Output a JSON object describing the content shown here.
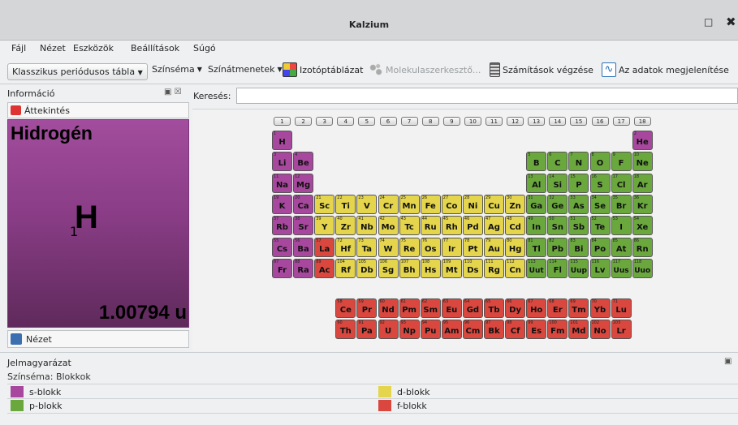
{
  "window": {
    "title": "Kalzium"
  },
  "menu": [
    "Fájl",
    "Nézet",
    "Eszközök",
    "Beállítások",
    "Súgó"
  ],
  "toolbar": {
    "table_combo": "Klasszikus periódusos tábla",
    "color_scheme": "Színséma",
    "gradients": "Színátmenetek",
    "isotope": "Izotóptáblázat",
    "molecule": "Molekulaszerkesztő...",
    "calc": "Számítások végzése",
    "data": "Az adatok megjelenítése"
  },
  "panel": {
    "title": "Információ",
    "overview": "Áttekintés",
    "view": "Nézet"
  },
  "element": {
    "name": "Hidrogén",
    "symbol": "H",
    "number": "1",
    "mass": "1.00794 u"
  },
  "search": {
    "label": "Keresés:",
    "value": ""
  },
  "groups": [
    "1",
    "2",
    "3",
    "4",
    "5",
    "6",
    "7",
    "8",
    "9",
    "10",
    "11",
    "12",
    "13",
    "14",
    "15",
    "16",
    "17",
    "18"
  ],
  "colors": {
    "s": "#a7489e",
    "p": "#6aa83d",
    "d": "#e4d54c",
    "f": "#d9473e"
  },
  "elements": [
    [
      1,
      "H",
      1,
      1,
      "s"
    ],
    [
      2,
      "He",
      1,
      18,
      "s"
    ],
    [
      3,
      "Li",
      2,
      1,
      "s"
    ],
    [
      4,
      "Be",
      2,
      2,
      "s"
    ],
    [
      5,
      "B",
      2,
      13,
      "p"
    ],
    [
      6,
      "C",
      2,
      14,
      "p"
    ],
    [
      7,
      "N",
      2,
      15,
      "p"
    ],
    [
      8,
      "O",
      2,
      16,
      "p"
    ],
    [
      9,
      "F",
      2,
      17,
      "p"
    ],
    [
      10,
      "Ne",
      2,
      18,
      "p"
    ],
    [
      11,
      "Na",
      3,
      1,
      "s"
    ],
    [
      12,
      "Mg",
      3,
      2,
      "s"
    ],
    [
      13,
      "Al",
      3,
      13,
      "p"
    ],
    [
      14,
      "Si",
      3,
      14,
      "p"
    ],
    [
      15,
      "P",
      3,
      15,
      "p"
    ],
    [
      16,
      "S",
      3,
      16,
      "p"
    ],
    [
      17,
      "Cl",
      3,
      17,
      "p"
    ],
    [
      18,
      "Ar",
      3,
      18,
      "p"
    ],
    [
      19,
      "K",
      4,
      1,
      "s"
    ],
    [
      20,
      "Ca",
      4,
      2,
      "s"
    ],
    [
      21,
      "Sc",
      4,
      3,
      "d"
    ],
    [
      22,
      "Ti",
      4,
      4,
      "d"
    ],
    [
      23,
      "V",
      4,
      5,
      "d"
    ],
    [
      24,
      "Cr",
      4,
      6,
      "d"
    ],
    [
      25,
      "Mn",
      4,
      7,
      "d"
    ],
    [
      26,
      "Fe",
      4,
      8,
      "d"
    ],
    [
      27,
      "Co",
      4,
      9,
      "d"
    ],
    [
      28,
      "Ni",
      4,
      10,
      "d"
    ],
    [
      29,
      "Cu",
      4,
      11,
      "d"
    ],
    [
      30,
      "Zn",
      4,
      12,
      "d"
    ],
    [
      31,
      "Ga",
      4,
      13,
      "p"
    ],
    [
      32,
      "Ge",
      4,
      14,
      "p"
    ],
    [
      33,
      "As",
      4,
      15,
      "p"
    ],
    [
      34,
      "Se",
      4,
      16,
      "p"
    ],
    [
      35,
      "Br",
      4,
      17,
      "p"
    ],
    [
      36,
      "Kr",
      4,
      18,
      "p"
    ],
    [
      37,
      "Rb",
      5,
      1,
      "s"
    ],
    [
      38,
      "Sr",
      5,
      2,
      "s"
    ],
    [
      39,
      "Y",
      5,
      3,
      "d"
    ],
    [
      40,
      "Zr",
      5,
      4,
      "d"
    ],
    [
      41,
      "Nb",
      5,
      5,
      "d"
    ],
    [
      42,
      "Mo",
      5,
      6,
      "d"
    ],
    [
      43,
      "Tc",
      5,
      7,
      "d"
    ],
    [
      44,
      "Ru",
      5,
      8,
      "d"
    ],
    [
      45,
      "Rh",
      5,
      9,
      "d"
    ],
    [
      46,
      "Pd",
      5,
      10,
      "d"
    ],
    [
      47,
      "Ag",
      5,
      11,
      "d"
    ],
    [
      48,
      "Cd",
      5,
      12,
      "d"
    ],
    [
      49,
      "In",
      5,
      13,
      "p"
    ],
    [
      50,
      "Sn",
      5,
      14,
      "p"
    ],
    [
      51,
      "Sb",
      5,
      15,
      "p"
    ],
    [
      52,
      "Te",
      5,
      16,
      "p"
    ],
    [
      53,
      "I",
      5,
      17,
      "p"
    ],
    [
      54,
      "Xe",
      5,
      18,
      "p"
    ],
    [
      55,
      "Cs",
      6,
      1,
      "s"
    ],
    [
      56,
      "Ba",
      6,
      2,
      "s"
    ],
    [
      57,
      "La",
      6,
      3,
      "f"
    ],
    [
      72,
      "Hf",
      6,
      4,
      "d"
    ],
    [
      73,
      "Ta",
      6,
      5,
      "d"
    ],
    [
      74,
      "W",
      6,
      6,
      "d"
    ],
    [
      75,
      "Re",
      6,
      7,
      "d"
    ],
    [
      76,
      "Os",
      6,
      8,
      "d"
    ],
    [
      77,
      "Ir",
      6,
      9,
      "d"
    ],
    [
      78,
      "Pt",
      6,
      10,
      "d"
    ],
    [
      79,
      "Au",
      6,
      11,
      "d"
    ],
    [
      80,
      "Hg",
      6,
      12,
      "d"
    ],
    [
      81,
      "Tl",
      6,
      13,
      "p"
    ],
    [
      82,
      "Pb",
      6,
      14,
      "p"
    ],
    [
      83,
      "Bi",
      6,
      15,
      "p"
    ],
    [
      84,
      "Po",
      6,
      16,
      "p"
    ],
    [
      85,
      "At",
      6,
      17,
      "p"
    ],
    [
      86,
      "Rn",
      6,
      18,
      "p"
    ],
    [
      87,
      "Fr",
      7,
      1,
      "s"
    ],
    [
      88,
      "Ra",
      7,
      2,
      "s"
    ],
    [
      89,
      "Ac",
      7,
      3,
      "f"
    ],
    [
      104,
      "Rf",
      7,
      4,
      "d"
    ],
    [
      105,
      "Db",
      7,
      5,
      "d"
    ],
    [
      106,
      "Sg",
      7,
      6,
      "d"
    ],
    [
      107,
      "Bh",
      7,
      7,
      "d"
    ],
    [
      108,
      "Hs",
      7,
      8,
      "d"
    ],
    [
      109,
      "Mt",
      7,
      9,
      "d"
    ],
    [
      110,
      "Ds",
      7,
      10,
      "d"
    ],
    [
      111,
      "Rg",
      7,
      11,
      "d"
    ],
    [
      112,
      "Cn",
      7,
      12,
      "d"
    ],
    [
      113,
      "Uut",
      7,
      13,
      "p"
    ],
    [
      114,
      "Fl",
      7,
      14,
      "p"
    ],
    [
      115,
      "Uup",
      7,
      15,
      "p"
    ],
    [
      116,
      "Lv",
      7,
      16,
      "p"
    ],
    [
      117,
      "Uus",
      7,
      17,
      "p"
    ],
    [
      118,
      "Uuo",
      7,
      18,
      "p"
    ],
    [
      58,
      "Ce",
      9,
      4,
      "f"
    ],
    [
      59,
      "Pr",
      9,
      5,
      "f"
    ],
    [
      60,
      "Nd",
      9,
      6,
      "f"
    ],
    [
      61,
      "Pm",
      9,
      7,
      "f"
    ],
    [
      62,
      "Sm",
      9,
      8,
      "f"
    ],
    [
      63,
      "Eu",
      9,
      9,
      "f"
    ],
    [
      64,
      "Gd",
      9,
      10,
      "f"
    ],
    [
      65,
      "Tb",
      9,
      11,
      "f"
    ],
    [
      66,
      "Dy",
      9,
      12,
      "f"
    ],
    [
      67,
      "Ho",
      9,
      13,
      "f"
    ],
    [
      68,
      "Er",
      9,
      14,
      "f"
    ],
    [
      69,
      "Tm",
      9,
      15,
      "f"
    ],
    [
      70,
      "Yb",
      9,
      16,
      "f"
    ],
    [
      71,
      "Lu",
      9,
      17,
      "f"
    ],
    [
      90,
      "Th",
      10,
      4,
      "f"
    ],
    [
      91,
      "Pa",
      10,
      5,
      "f"
    ],
    [
      92,
      "U",
      10,
      6,
      "f"
    ],
    [
      93,
      "Np",
      10,
      7,
      "f"
    ],
    [
      94,
      "Pu",
      10,
      8,
      "f"
    ],
    [
      95,
      "Am",
      10,
      9,
      "f"
    ],
    [
      96,
      "Cm",
      10,
      10,
      "f"
    ],
    [
      97,
      "Bk",
      10,
      11,
      "f"
    ],
    [
      98,
      "Cf",
      10,
      12,
      "f"
    ],
    [
      99,
      "Es",
      10,
      13,
      "f"
    ],
    [
      100,
      "Fm",
      10,
      14,
      "f"
    ],
    [
      101,
      "Md",
      10,
      15,
      "f"
    ],
    [
      102,
      "No",
      10,
      16,
      "f"
    ],
    [
      103,
      "Lr",
      10,
      17,
      "f"
    ]
  ],
  "legend": {
    "title": "Jelmagyarázat",
    "scheme": "Színséma: Blokkok",
    "items": [
      {
        "label": "s-blokk",
        "color": "#a7489e"
      },
      {
        "label": "d-blokk",
        "color": "#e4d54c"
      },
      {
        "label": "p-blokk",
        "color": "#6aa83d"
      },
      {
        "label": "f-blokk",
        "color": "#d9473e"
      }
    ]
  }
}
